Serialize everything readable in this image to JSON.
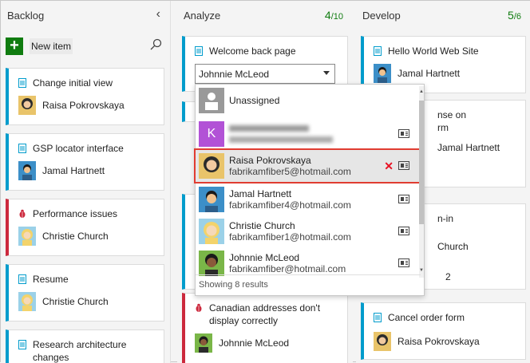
{
  "colors": {
    "accent_green": "#107c10",
    "story_blue": "#009ccc",
    "bug_red": "#cc293d",
    "highlight_red": "#e03c31"
  },
  "columns": {
    "backlog": {
      "title": "Backlog",
      "collapse_icon": "chevron-left-icon"
    },
    "analyze": {
      "title": "Analyze",
      "count": "4",
      "limit": "/10"
    },
    "develop": {
      "title": "Develop",
      "count": "5",
      "limit": "/6"
    }
  },
  "backlog": {
    "new_item_label": "New item",
    "cards": [
      {
        "title": "Change initial view",
        "assignee": "Raisa Pokrovskaya",
        "type": "story"
      },
      {
        "title": "GSP locator interface",
        "assignee": "Jamal Hartnett",
        "type": "story"
      },
      {
        "title": "Performance issues",
        "assignee": "Christie Church",
        "type": "bug"
      },
      {
        "title": "Resume",
        "assignee": "Christie Church",
        "type": "story"
      },
      {
        "title": "Research architecture changes",
        "assignee": "",
        "type": "story"
      }
    ]
  },
  "analyze": {
    "cards": [
      {
        "title": "Welcome back page",
        "type": "story"
      },
      {
        "title": "Canadian addresses don't display correctly",
        "assignee": "Johnnie McLeod",
        "type": "bug"
      }
    ],
    "assign_field_value": "Johnnie McLeod"
  },
  "dropdown": {
    "items": [
      {
        "name": "Unassigned",
        "email": ""
      },
      {
        "name": "",
        "email": "",
        "initial": "K"
      },
      {
        "name": "Raisa Pokrovskaya",
        "email": "fabrikamfiber5@hotmail.com",
        "selected": true
      },
      {
        "name": "Jamal Hartnett",
        "email": "fabrikamfiber4@hotmail.com"
      },
      {
        "name": "Christie Church",
        "email": "fabrikamfiber1@hotmail.com"
      },
      {
        "name": "Johnnie McLeod",
        "email": "fabrikamfiber@hotmail.com"
      }
    ],
    "remove_glyph": "✕",
    "footer": "Showing 8 results"
  },
  "develop": {
    "cards": [
      {
        "title": "Hello World Web Site",
        "assignee": "Jamal Hartnett"
      },
      {
        "title": "nse on",
        "title2": "rm"
      },
      {
        "title": "n-in"
      },
      {
        "title": "Cancel order form",
        "assignee": "Raisa Pokrovskaya"
      }
    ],
    "fragments": {
      "assignee_partial": "Jamal Hartnett",
      "church_partial": "Church",
      "number": "2"
    }
  }
}
